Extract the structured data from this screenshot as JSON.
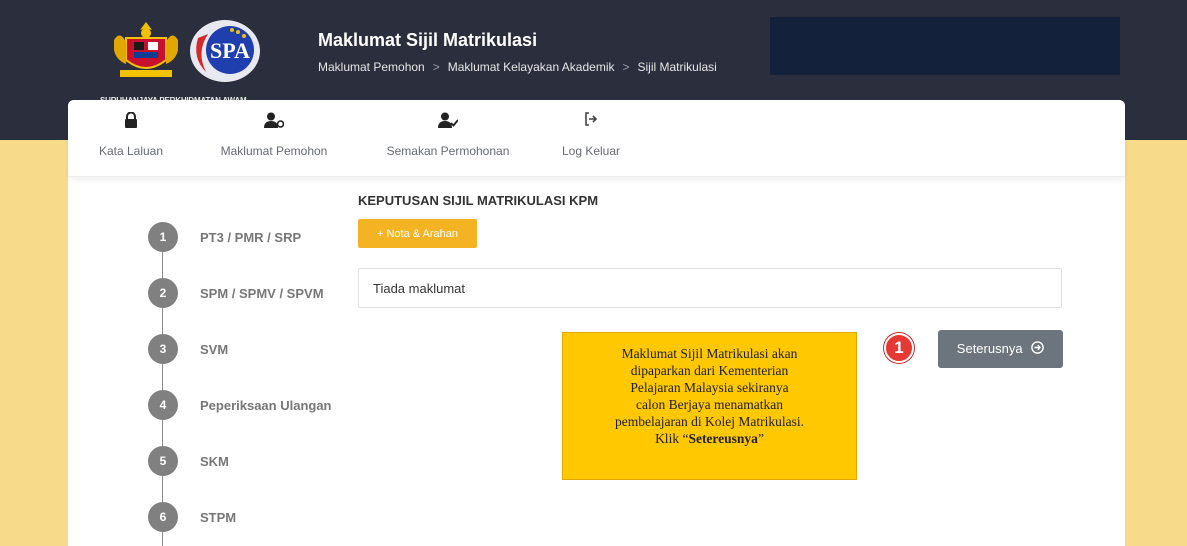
{
  "header": {
    "title": "Maklumat Sijil Matrikulasi",
    "logo_caption": "SURUHANJAYA PERKHIDMATAN AWAM",
    "breadcrumb": [
      "Maklumat Pemohon",
      "Maklumat Kelayakan Akademik",
      "Sijil Matrikulasi"
    ]
  },
  "nav": {
    "items": [
      {
        "label": "Kata Laluan",
        "icon": "lock-icon"
      },
      {
        "label": "Maklumat Pemohon",
        "icon": "user-info-icon"
      },
      {
        "label": "Semakan Permohonan",
        "icon": "user-check-icon"
      },
      {
        "label": "Log Keluar",
        "icon": "sign-out-icon"
      }
    ]
  },
  "steps": [
    {
      "number": "1",
      "label": "PT3 / PMR / SRP"
    },
    {
      "number": "2",
      "label": "SPM / SPMV / SPVM"
    },
    {
      "number": "3",
      "label": "SVM"
    },
    {
      "number": "4",
      "label": "Peperiksaan Ulangan"
    },
    {
      "number": "5",
      "label": "SKM"
    },
    {
      "number": "6",
      "label": "STPM"
    }
  ],
  "main": {
    "section_title": "KEPUTUSAN SIJIL MATRIKULASI KPM",
    "nota_button": "+ Nota & Arahan",
    "info_text": "Tiada maklumat",
    "next_button": "Seterusnya",
    "step_badge": "1"
  },
  "note": {
    "lines": [
      "Maklumat Sijil Matrikulasi akan",
      "dipaparkan dari Kementerian",
      "Pelajaran Malaysia sekiranya",
      "calon Berjaya menamatkan",
      "pembelajaran di Kolej Matrikulasi."
    ],
    "last_prefix": "Klik “",
    "last_bold": "Setereusnya",
    "last_suffix": "”"
  },
  "colors": {
    "topbar": "#2b2e3d",
    "page_bg": "#f7db8a",
    "accent_orange": "#f4b323",
    "note_yellow": "#ffc800",
    "badge_red": "#e53935",
    "button_gray": "#6c757d"
  }
}
